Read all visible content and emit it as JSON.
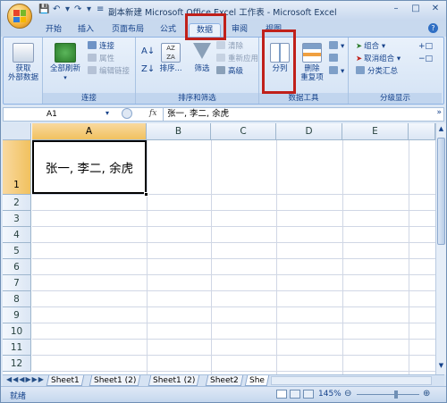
{
  "window": {
    "title": "副本新建 Microsoft Office Excel 工作表 - Microsoft Excel",
    "help_icon": "question-circle-icon"
  },
  "tabs": [
    {
      "label": "开始"
    },
    {
      "label": "插入"
    },
    {
      "label": "页面布局"
    },
    {
      "label": "公式"
    },
    {
      "label": "数据",
      "active": true
    },
    {
      "label": "审阅"
    },
    {
      "label": "视图"
    }
  ],
  "ribbon": {
    "get_external": {
      "label1": "获取",
      "label2": "外部数据"
    },
    "connections": {
      "group_label": "连接",
      "refresh_all": "全部刷新",
      "connections": "连接",
      "properties": "属性",
      "edit_links": "编辑链接"
    },
    "sort_filter": {
      "group_label": "排序和筛选",
      "sort": "排序...",
      "filter": "筛选",
      "clear": "清除",
      "reapply": "重新应用",
      "advanced": "高级"
    },
    "data_tools": {
      "group_label": "数据工具",
      "text_to_columns": "分列",
      "remove_dup1": "删除",
      "remove_dup2": "重复项"
    },
    "outline": {
      "group_label": "分级显示",
      "group": "组合",
      "ungroup": "取消组合",
      "subtotal": "分类汇总"
    }
  },
  "formula_bar": {
    "name_box": "A1",
    "fx": "fx",
    "content": "张一, 李二, 余虎"
  },
  "sheet": {
    "columns": [
      "A",
      "B",
      "C",
      "D",
      "E"
    ],
    "rows": [
      "1",
      "2",
      "3",
      "4",
      "5",
      "6",
      "7",
      "8",
      "9",
      "10",
      "11",
      "12"
    ],
    "cell_a1": "张一, 李二, 余虎"
  },
  "sheet_tabs": [
    "Sheet1",
    "Sheet1 (2)",
    "Sheet1 (2)",
    "Sheet2",
    "She"
  ],
  "status": {
    "ready": "就绪",
    "zoom": "145%"
  },
  "colors": {
    "highlight": "#c0201a",
    "ribbon_text": "#15428b",
    "selected_header": "#f1c15f"
  }
}
